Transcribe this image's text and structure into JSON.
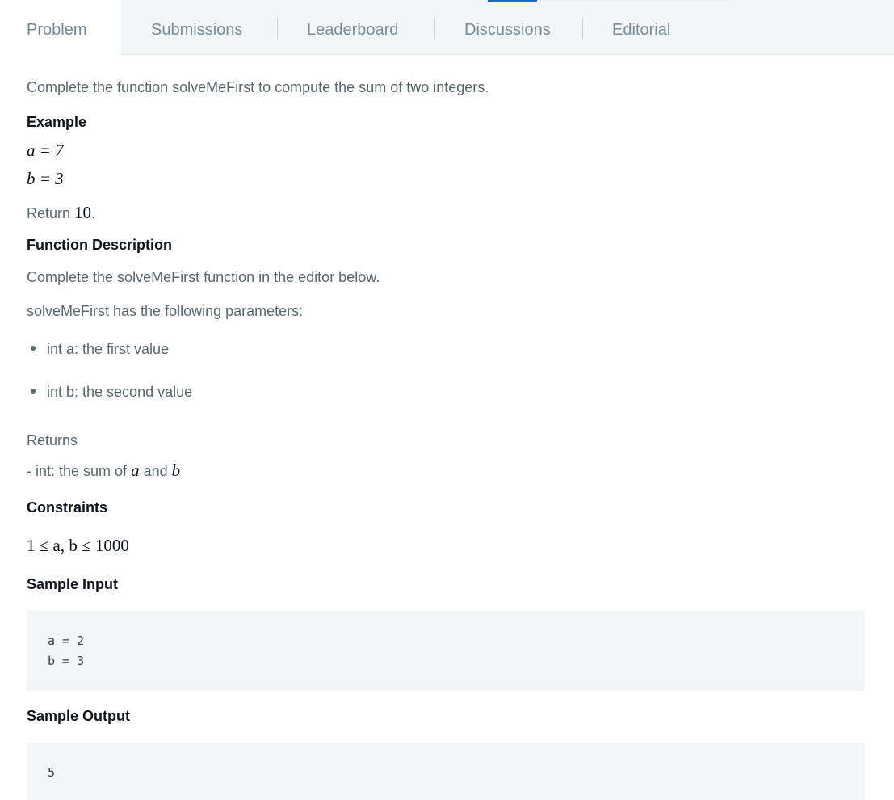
{
  "tabs": [
    {
      "label": "Problem",
      "active": true
    },
    {
      "label": "Submissions",
      "active": false
    },
    {
      "label": "Leaderboard",
      "active": false
    },
    {
      "label": "Discussions",
      "active": false
    },
    {
      "label": "Editorial",
      "active": false
    }
  ],
  "problem": {
    "intro": "Complete the function solveMeFirst to compute the sum of two integers.",
    "example_heading": "Example",
    "example_a": "a = 7",
    "example_b": "b = 3",
    "return_prefix": "Return ",
    "return_value": "10",
    "return_suffix": ".",
    "function_description_heading": "Function Description",
    "function_description_text": "Complete the solveMeFirst function in the editor below.",
    "parameters_intro": "solveMeFirst has the following parameters:",
    "parameters": [
      "int a: the first value",
      "int b: the second value"
    ],
    "returns_heading": "Returns",
    "returns_text_prefix": "- int: the sum of ",
    "returns_var_a": "a",
    "returns_and": " and ",
    "returns_var_b": "b",
    "constraints_heading": "Constraints",
    "constraints_text": "1 ≤ a, b ≤ 1000",
    "sample_input_heading": "Sample Input",
    "sample_input_lines": [
      "a = 2",
      "b = 3"
    ],
    "sample_output_heading": "Sample Output",
    "sample_output_lines": [
      "5"
    ]
  },
  "colors": {
    "tab_bar_bg": "#f3f6f7",
    "accent": "#1d6ac7",
    "heading": "#0e141e",
    "body_text": "#576871",
    "code_bg": "#f3f6f7"
  }
}
